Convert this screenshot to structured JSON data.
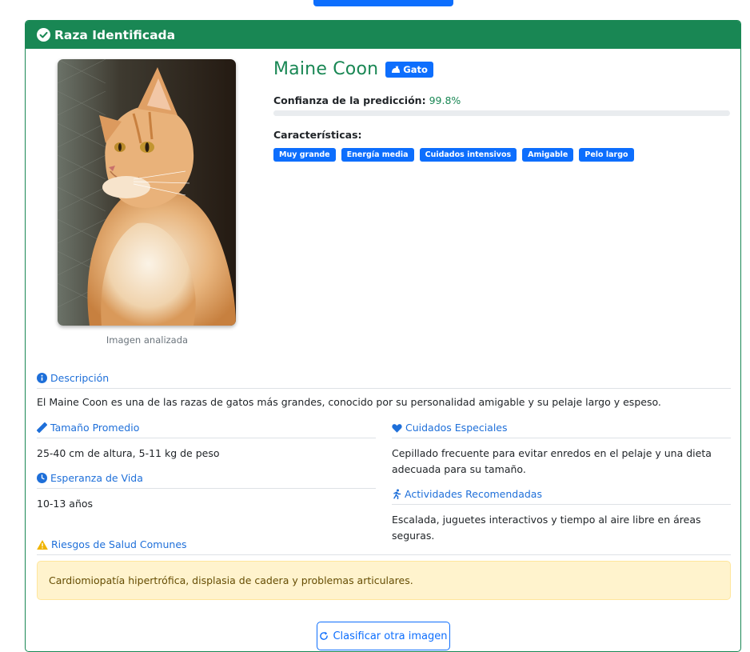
{
  "header": {
    "title": "Raza Identificada"
  },
  "image": {
    "caption": "Imagen analizada"
  },
  "result": {
    "breed": "Maine Coon",
    "type_label": "Gato",
    "confidence_label": "Confianza de la predicción:",
    "confidence_value": "99.8%",
    "confidence_fraction": 0.998,
    "characteristics_title": "Características:",
    "characteristics": [
      "Muy grande",
      "Energía media",
      "Cuidados intensivos",
      "Amigable",
      "Pelo largo"
    ]
  },
  "description": {
    "title": "Descripción",
    "text": "El Maine Coon es una de las razas de gatos más grandes, conocido por su personalidad amigable y su pelaje largo y espeso."
  },
  "size": {
    "title": "Tamaño Promedio",
    "text": "25-40 cm de altura, 5-11 kg de peso"
  },
  "lifespan": {
    "title": "Esperanza de Vida",
    "text": "10-13 años"
  },
  "care": {
    "title": "Cuidados Especiales",
    "line1": "Cepillado frecuente para evitar enredos en el pelaje y una dieta",
    "line2": "adecuada para su tamaño."
  },
  "activities": {
    "title": "Actividades Recomendadas",
    "text": "Escalada, juguetes interactivos y tiempo al aire libre en áreas seguras."
  },
  "health": {
    "title": "Riesgos de Salud Comunes",
    "text": "Cardiomiopatía hipertrófica, displasia de cadera y problemas articulares."
  },
  "actions": {
    "again_label": "Clasificar otra imagen"
  },
  "colors": {
    "success": "#198754",
    "primary": "#0d6efd",
    "warning_bg": "#fff3cd"
  },
  "icons": {
    "header": "check-circle-icon",
    "type": "cat-icon",
    "description": "info-circle-icon",
    "size": "ruler-icon",
    "lifespan": "clock-icon",
    "care": "heart-icon",
    "activities": "running-icon",
    "health": "warning-icon",
    "again": "refresh-icon"
  }
}
